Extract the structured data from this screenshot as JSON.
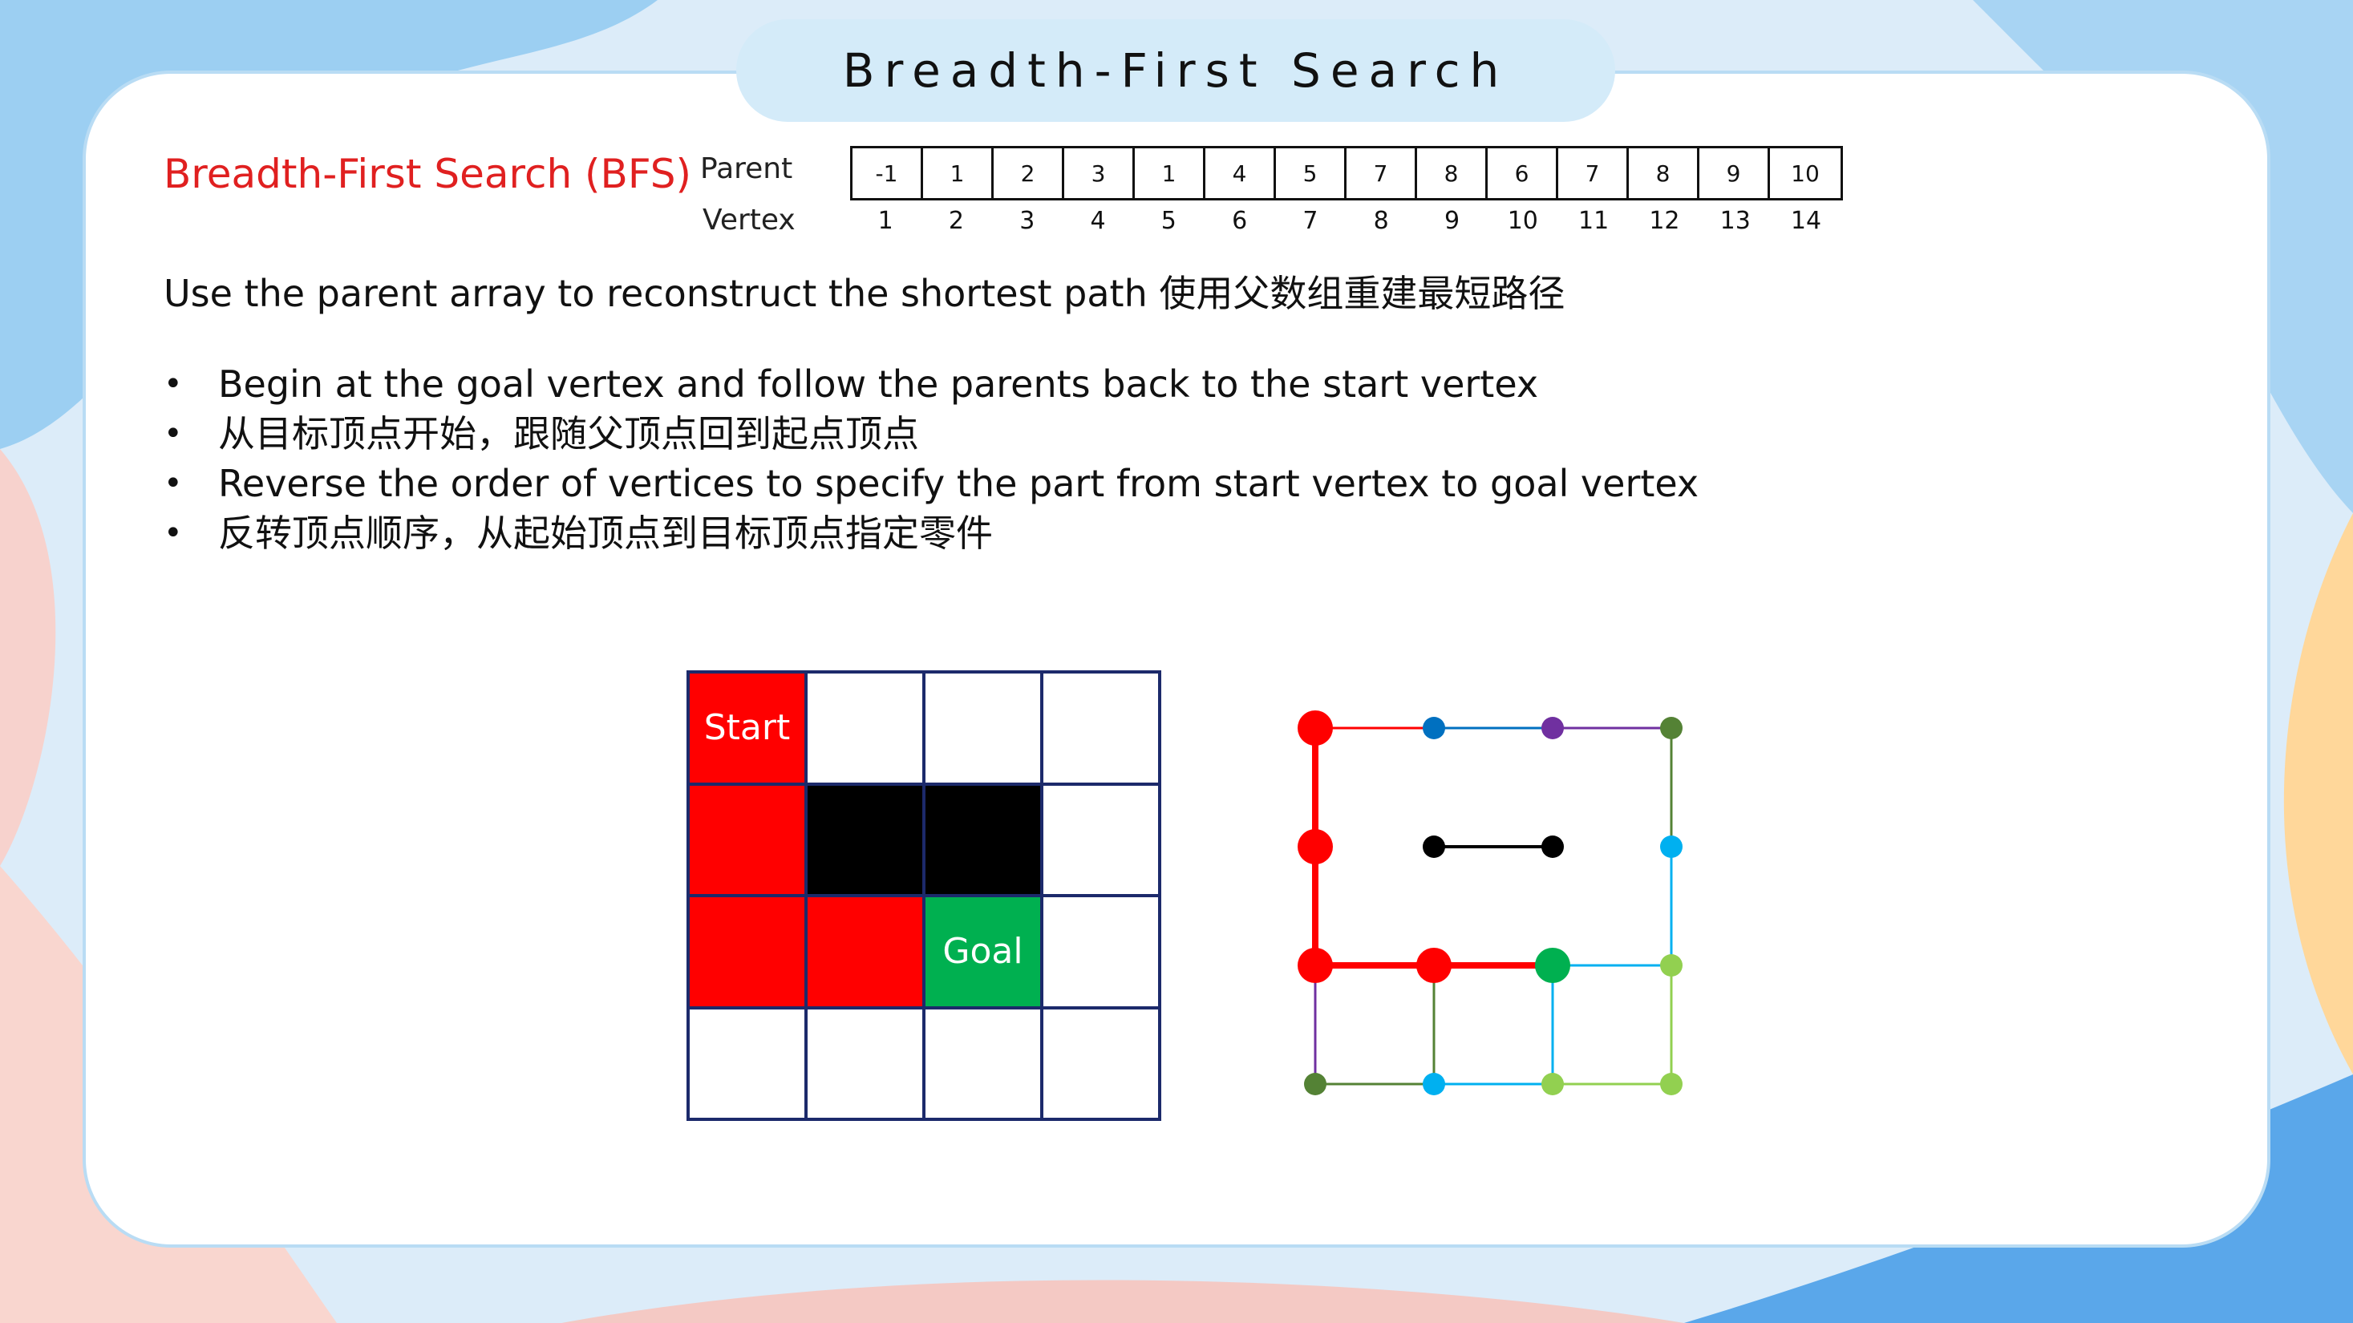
{
  "title": "Breadth-First Search",
  "subtitle": "Breadth-First Search (BFS)",
  "table": {
    "parent_label": "Parent",
    "vertex_label": "Vertex",
    "parents": [
      "-1",
      "1",
      "2",
      "3",
      "1",
      "4",
      "5",
      "7",
      "8",
      "6",
      "7",
      "8",
      "9",
      "10"
    ],
    "vertices": [
      "1",
      "2",
      "3",
      "4",
      "5",
      "6",
      "7",
      "8",
      "9",
      "10",
      "11",
      "12",
      "13",
      "14"
    ]
  },
  "instruction": "Use the parent array to reconstruct the shortest path  使用父数组重建最短路径",
  "bullets": [
    "Begin at the goal vertex and follow the parents back to the start vertex",
    "从目标顶点开始，跟随父顶点回到起点顶点",
    "Reverse the order of vertices to specify the part from start vertex to goal vertex",
    "反转顶点顺序，从起始顶点到目标顶点指定零件"
  ],
  "grid": {
    "start_label": "Start",
    "goal_label": "Goal",
    "cells": [
      [
        "start",
        "empty",
        "empty",
        "empty"
      ],
      [
        "path",
        "wall",
        "wall",
        "empty"
      ],
      [
        "path",
        "path",
        "goal",
        "empty"
      ],
      [
        "empty",
        "empty",
        "empty",
        "empty"
      ]
    ]
  },
  "colors": {
    "accent_red": "#e02020",
    "path_red": "#ff0000",
    "goal_green": "#00b050",
    "wall": "#000000",
    "grid_border": "#1c2a6b"
  },
  "graph": {
    "nodes": [
      {
        "id": "1",
        "col": 0,
        "row": 0,
        "color": "#ff0000",
        "big": true
      },
      {
        "id": "2",
        "col": 1,
        "row": 0,
        "color": "#0070c0",
        "big": false
      },
      {
        "id": "3",
        "col": 2,
        "row": 0,
        "color": "#7030a0",
        "big": false
      },
      {
        "id": "4",
        "col": 3,
        "row": 0,
        "color": "#548235",
        "big": false
      },
      {
        "id": "5",
        "col": 0,
        "row": 1,
        "color": "#ff0000",
        "big": true
      },
      {
        "id": "w1",
        "col": 1,
        "row": 1,
        "color": "#000000",
        "big": false
      },
      {
        "id": "w2",
        "col": 2,
        "row": 1,
        "color": "#000000",
        "big": false
      },
      {
        "id": "6",
        "col": 3,
        "row": 1,
        "color": "#00b0f0",
        "big": false
      },
      {
        "id": "7",
        "col": 0,
        "row": 2,
        "color": "#ff0000",
        "big": true
      },
      {
        "id": "8",
        "col": 1,
        "row": 2,
        "color": "#ff0000",
        "big": true
      },
      {
        "id": "9",
        "col": 2,
        "row": 2,
        "color": "#00b050",
        "big": true
      },
      {
        "id": "10",
        "col": 3,
        "row": 2,
        "color": "#92d050",
        "big": false
      },
      {
        "id": "11",
        "col": 0,
        "row": 3,
        "color": "#548235",
        "big": false
      },
      {
        "id": "12",
        "col": 1,
        "row": 3,
        "color": "#00b0f0",
        "big": false
      },
      {
        "id": "13",
        "col": 2,
        "row": 3,
        "color": "#92d050",
        "big": false
      },
      {
        "id": "14",
        "col": 3,
        "row": 3,
        "color": "#92d050",
        "big": false
      }
    ],
    "edges": [
      {
        "a": "1",
        "b": "2",
        "color": "#ff0000",
        "path": false
      },
      {
        "a": "2",
        "b": "3",
        "color": "#0070c0",
        "path": false
      },
      {
        "a": "3",
        "b": "4",
        "color": "#7030a0",
        "path": false
      },
      {
        "a": "4",
        "b": "6",
        "color": "#548235",
        "path": false
      },
      {
        "a": "6",
        "b": "10",
        "color": "#00b0f0",
        "path": false
      },
      {
        "a": "10",
        "b": "14",
        "color": "#92d050",
        "path": false
      },
      {
        "a": "w1",
        "b": "w2",
        "color": "#000000",
        "path": false
      },
      {
        "a": "9",
        "b": "10",
        "color": "#00b0f0",
        "path": false
      },
      {
        "a": "7",
        "b": "11",
        "color": "#7030a0",
        "path": false
      },
      {
        "a": "8",
        "b": "12",
        "color": "#548235",
        "path": false
      },
      {
        "a": "9",
        "b": "13",
        "color": "#00b0f0",
        "path": false
      },
      {
        "a": "11",
        "b": "12",
        "color": "#548235",
        "path": false
      },
      {
        "a": "12",
        "b": "13",
        "color": "#00b0f0",
        "path": false
      },
      {
        "a": "13",
        "b": "14",
        "color": "#92d050",
        "path": false
      },
      {
        "a": "1",
        "b": "5",
        "color": "#ff0000",
        "path": true
      },
      {
        "a": "5",
        "b": "7",
        "color": "#ff0000",
        "path": true
      },
      {
        "a": "7",
        "b": "8",
        "color": "#ff0000",
        "path": true
      },
      {
        "a": "8",
        "b": "9",
        "color": "#ff0000",
        "path": true
      }
    ]
  }
}
